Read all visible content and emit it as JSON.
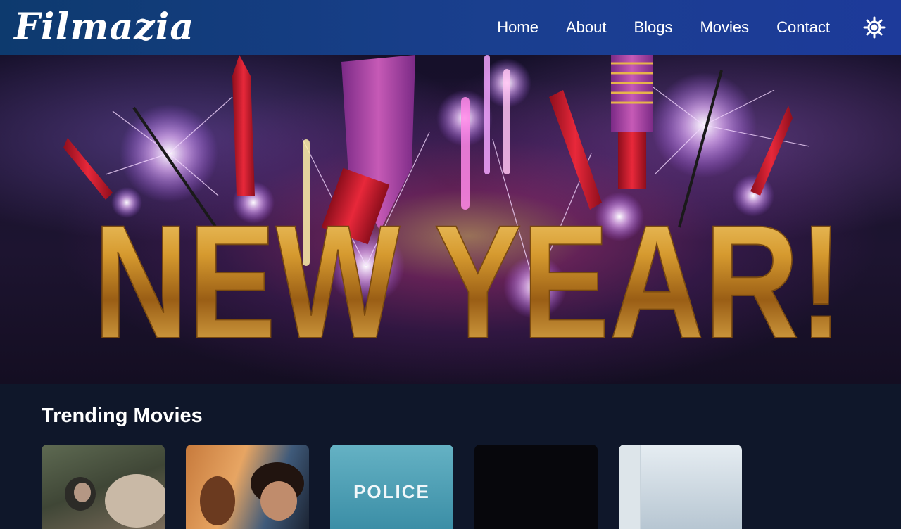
{
  "navbar": {
    "logo": "Filmazia",
    "links": [
      "Home",
      "About",
      "Blogs",
      "Movies",
      "Contact"
    ],
    "theme_toggle_icon": "sun-icon",
    "background": "#1a3f8f"
  },
  "hero": {
    "banner_text": "NEW YEAR!",
    "accent_gold": "#e3a83a"
  },
  "trending": {
    "title": "Trending Movies",
    "cards": [
      {
        "label": ""
      },
      {
        "label": ""
      },
      {
        "label": "POLICE"
      },
      {
        "label": ""
      },
      {
        "label": ""
      }
    ]
  }
}
